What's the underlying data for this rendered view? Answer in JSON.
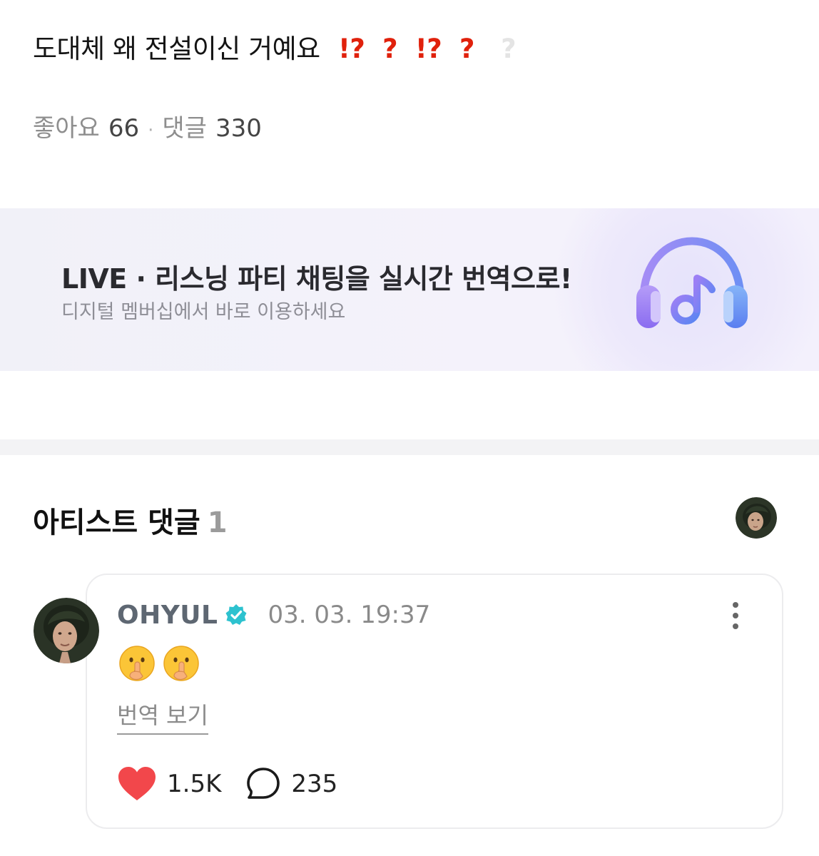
{
  "post": {
    "title": "도대체 왜 전설이신 거예요",
    "title_marks": [
      "⁉️",
      "❓",
      "⁉️",
      "❓",
      "❔"
    ],
    "likes_label": "좋아요",
    "likes_count": "66",
    "separator": "·",
    "comments_label": "댓글",
    "comments_count": "330"
  },
  "banner": {
    "title": "LIVE · 리스닝 파티 채팅을 실시간 번역으로!",
    "subtitle": "디지털 멤버십에서 바로 이용하세요",
    "icon": "headphones-music-icon"
  },
  "artist_comments": {
    "title": "아티스트 댓글",
    "count": "1"
  },
  "comment": {
    "author": "OHYUL",
    "verified": true,
    "timestamp": "03. 03. 19:37",
    "body_emojis": [
      "🤫",
      "🤫"
    ],
    "translate_label": "번역 보기",
    "likes": "1.5K",
    "replies": "235"
  },
  "colors": {
    "accent_red": "#e0210c",
    "verified_teal": "#2dc2cf",
    "heart_red": "#f2474b",
    "banner_purple": "#8a6cf0"
  }
}
